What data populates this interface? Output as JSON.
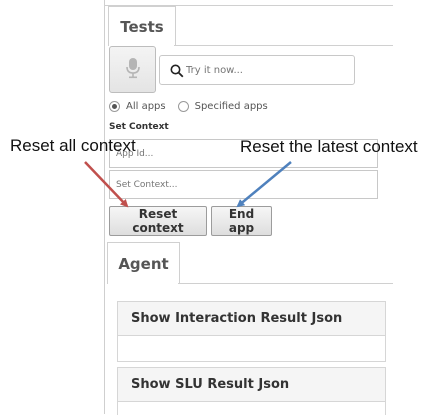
{
  "tabs": {
    "tests": "Tests",
    "agent": "Agent"
  },
  "search": {
    "placeholder": "Try it now..."
  },
  "radios": {
    "all_apps": "All apps",
    "specified_apps": "Specified apps",
    "selected": "All apps"
  },
  "set_context": {
    "label": "Set Context",
    "app_id_placeholder": "App Id...",
    "context_placeholder": "Set Context..."
  },
  "buttons": {
    "reset_context": "Reset context",
    "end_app": "End app"
  },
  "sections": {
    "interaction_result": "Show Interaction Result Json",
    "slu_result": "Show SLU Result Json"
  },
  "annotations": {
    "left": "Reset all context",
    "right": "Reset the latest context",
    "left_arrow_color": "#c0504d",
    "right_arrow_color": "#4f81bd"
  },
  "icons": {
    "mic": "microphone-icon",
    "search": "search-icon"
  }
}
